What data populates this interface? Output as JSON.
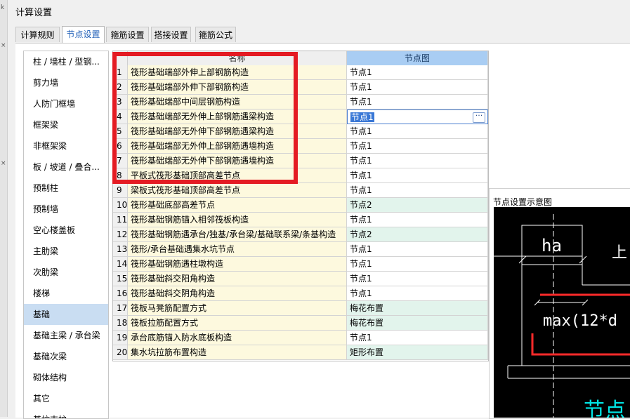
{
  "window": {
    "title": "计算设置"
  },
  "tabs": [
    {
      "label": "计算规则",
      "active": false
    },
    {
      "label": "节点设置",
      "active": true
    },
    {
      "label": "箍筋设置",
      "active": false
    },
    {
      "label": "搭接设置",
      "active": false
    },
    {
      "label": "箍筋公式",
      "active": false
    }
  ],
  "categories": [
    "柱 / 墙柱 / 型钢...",
    "剪力墙",
    "人防门框墙",
    "框架梁",
    "非框架梁",
    "板 / 坡道 / 叠合...",
    "预制柱",
    "预制墙",
    "空心楼盖板",
    "主肋梁",
    "次肋梁",
    "楼梯",
    "基础",
    "基础主梁 / 承台梁",
    "基础次梁",
    "砌体结构",
    "其它",
    "基坑支护"
  ],
  "selected_category": "基础",
  "grid": {
    "col_name": "名称",
    "col_node": "节点图",
    "rows": [
      {
        "num": "1",
        "name": "筏形基础端部外伸上部钢筋构造",
        "node": "节点1"
      },
      {
        "num": "2",
        "name": "筏形基础端部外伸下部钢筋构造",
        "node": "节点1"
      },
      {
        "num": "3",
        "name": "筏形基础端部中间层钢筋构造",
        "node": "节点1"
      },
      {
        "num": "4",
        "name": "筏形基础端部无外伸上部钢筋遇梁构造",
        "node": "节点1"
      },
      {
        "num": "5",
        "name": "筏形基础端部无外伸下部钢筋遇梁构造",
        "node": "节点1"
      },
      {
        "num": "6",
        "name": "筏形基础端部无外伸上部钢筋遇墙构造",
        "node": "节点1"
      },
      {
        "num": "7",
        "name": "筏形基础端部无外伸下部钢筋遇墙构造",
        "node": "节点1"
      },
      {
        "num": "8",
        "name": "平板式筏形基础顶部高差节点",
        "node": "节点1"
      },
      {
        "num": "9",
        "name": "梁板式筏形基础顶部高差节点",
        "node": "节点1"
      },
      {
        "num": "10",
        "name": "筏形基础底部高差节点",
        "node": "节点2"
      },
      {
        "num": "11",
        "name": "筏形基础钢筋锚入相邻筏板构造",
        "node": "节点1"
      },
      {
        "num": "12",
        "name": "筏形基础钢筋遇承台/独基/承台梁/基础联系梁/条基构造",
        "node": "节点2"
      },
      {
        "num": "13",
        "name": "筏形/承台基础遇集水坑节点",
        "node": "节点1"
      },
      {
        "num": "14",
        "name": "筏形基础钢筋遇柱墩构造",
        "node": "节点1"
      },
      {
        "num": "15",
        "name": "筏形基础斜交阳角构造",
        "node": "节点1"
      },
      {
        "num": "16",
        "name": "筏形基础斜交阴角构造",
        "node": "节点1"
      },
      {
        "num": "17",
        "name": "筏板马凳筋配置方式",
        "node": "梅花布置"
      },
      {
        "num": "18",
        "name": "筏板拉筋配置方式",
        "node": "梅花布置"
      },
      {
        "num": "19",
        "name": "承台底筋锚入防水底板构造",
        "node": "节点1"
      },
      {
        "num": "20",
        "name": "集水坑拉筋布置构造",
        "node": "矩形布置"
      }
    ],
    "selected_row": 4,
    "edit_button": "···"
  },
  "diagram": {
    "title": "节点设置示意图",
    "labels": {
      "ha": "ha",
      "top": "上",
      "max": "max(12*d",
      "node": "节点"
    },
    "colors": {
      "background": "#000000",
      "lines": "#ffffff",
      "rebar": "#ff2a2a",
      "caption": "#00e5e5"
    }
  },
  "highlight": {
    "color": "#e41b23",
    "label": "annotation-box"
  }
}
